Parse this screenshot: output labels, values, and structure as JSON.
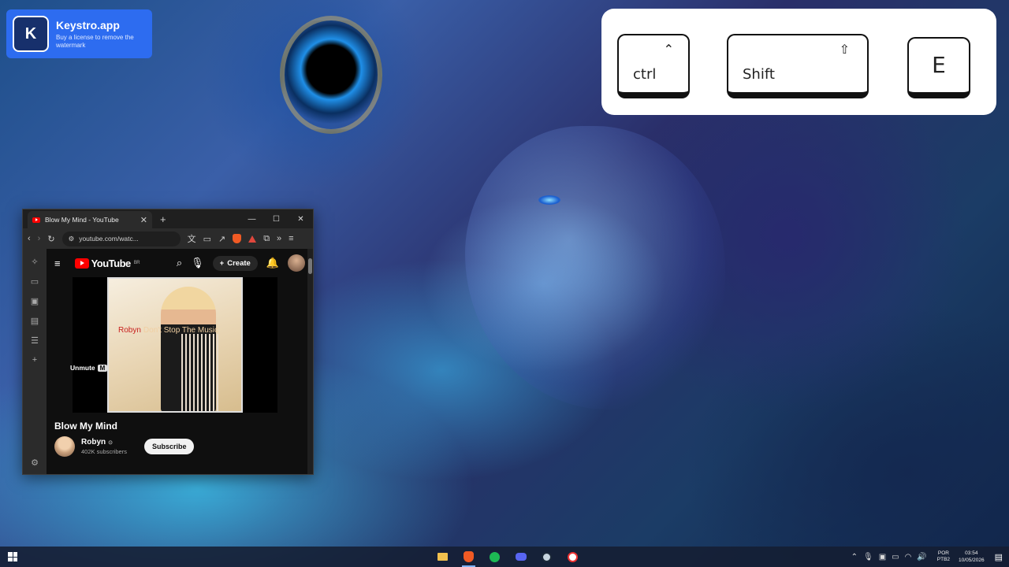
{
  "keystro": {
    "logo_letter": "K",
    "title": "Keystro.app",
    "subtitle": "Buy a license to remove the watermark"
  },
  "keys": {
    "ctrl": {
      "label": "ctrl",
      "symbol": "⌃"
    },
    "shift": {
      "label": "Shift",
      "symbol": "⇧"
    },
    "e": {
      "label": "E"
    }
  },
  "browser": {
    "tab_title": "Blow My Mind - YouTube",
    "address": "youtube.com/watc...",
    "youtube": {
      "logo_text": "YouTube",
      "region": "BR",
      "create_label": "Create",
      "album_artist": "Robyn",
      "album_song": "Don't Stop The Music",
      "unmute_label": "Unmute",
      "unmute_key": "M",
      "video_title": "Blow My Mind",
      "channel_name": "Robyn",
      "channel_subs": "402K subscribers",
      "subscribe_label": "Subscribe"
    }
  },
  "taskbar": {
    "language": [
      "POR",
      "PTB2"
    ],
    "time": "03:54",
    "date": "10/05/2026"
  }
}
